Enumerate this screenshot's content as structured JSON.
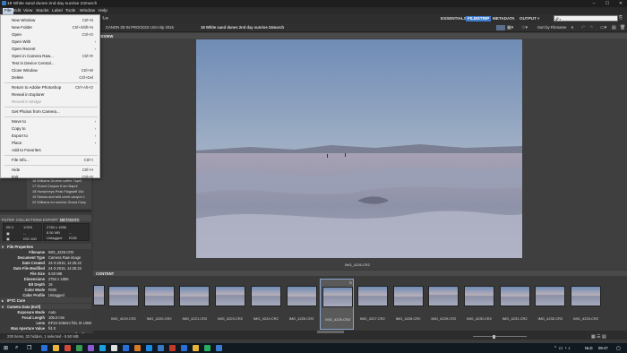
{
  "titlebar": {
    "title": "18 White sand dunes 2nd day sunrise 24march",
    "minimize": "–",
    "maximize": "☐",
    "close": "✕"
  },
  "menubar": {
    "items": [
      "File",
      "Edit",
      "View",
      "Stacks",
      "Label",
      "Tools",
      "Window",
      "Help"
    ]
  },
  "file_menu": {
    "groups": [
      [
        {
          "label": "New Window",
          "shortcut": "Ctrl+N"
        },
        {
          "label": "New Folder",
          "shortcut": "Ctrl+Shift+N"
        },
        {
          "label": "Open",
          "shortcut": "Ctrl+O"
        },
        {
          "label": "Open With",
          "submenu": true
        },
        {
          "label": "Open Recent",
          "submenu": true
        },
        {
          "label": "Open in Camera Raw...",
          "shortcut": "Ctrl+R"
        },
        {
          "label": "Test in Device Central..."
        },
        {
          "label": "Close Window",
          "shortcut": "Ctrl+W"
        },
        {
          "label": "Delete",
          "shortcut": "Ctrl+Del"
        }
      ],
      [
        {
          "label": "Return to Adobe Photoshop",
          "shortcut": "Ctrl+Alt+O"
        },
        {
          "label": "Reveal in Explorer"
        },
        {
          "label": "Reveal in Bridge",
          "disabled": true
        }
      ],
      [
        {
          "label": "Get Photos from Camera..."
        }
      ],
      [
        {
          "label": "Move to",
          "submenu": true
        },
        {
          "label": "Copy to",
          "submenu": true
        },
        {
          "label": "Export to",
          "submenu": true
        },
        {
          "label": "Place",
          "submenu": true
        },
        {
          "label": "Add to Favorites"
        }
      ],
      [
        {
          "label": "File Info...",
          "shortcut": "Ctrl+I"
        }
      ],
      [
        {
          "label": "Hide",
          "shortcut": "Ctrl+H"
        },
        {
          "label": "Exit",
          "shortcut": "Ctrl+Q"
        }
      ]
    ]
  },
  "workspaces": {
    "essentials": "ESSENTIALS",
    "filmstrip": "FILMSTRIP",
    "metadata": "METADATA",
    "output": "OUTPUT"
  },
  "search": {
    "placeholder": "𝒫 ▾"
  },
  "path": [
    "CANON 3D IN PROCESS",
    "USA trip 2015",
    "18 White sand dunes 2nd day sunrise 24march"
  ],
  "sort": {
    "label": "Sort by Filename"
  },
  "folders": [
    "16 Williams Grutnm coffee 7april",
    "17 Grand Canyon 8 arc Napril",
    "18 Humphreys Peak Flagstaff 10a",
    "19 Sidona and wild creek canyon 1",
    "20 Williams err sunrise Grand Cany"
  ],
  "left_tabs": {
    "filter": "FILTER",
    "collections": "COLLECTIONS",
    "export": "EXPORT",
    "metadata": "METADATA"
  },
  "meta_summary": {
    "aperture": "f/6.3",
    "shutter": "1/320",
    "size": "2784 x 1856",
    "filesize": "8.50 MB",
    "iso": "ISO 100",
    "tagged": "Untagged",
    "mode": "RGB"
  },
  "file_properties": {
    "header": "File Properties",
    "rows": [
      {
        "k": "Filename",
        "v": "IMG_4226.CR2"
      },
      {
        "k": "Document Type",
        "v": "Camera Raw image"
      },
      {
        "k": "Date Created",
        "v": "24-3-2015, 14:25:22"
      },
      {
        "k": "Date File Modified",
        "v": "24-3-2015, 14:25:22"
      },
      {
        "k": "File Size",
        "v": "8.50 MB"
      },
      {
        "k": "Dimensions",
        "v": "2784 x 1856"
      },
      {
        "k": "Bit Depth",
        "v": "16"
      },
      {
        "k": "Color Mode",
        "v": "RGB"
      },
      {
        "k": "Color Profile",
        "v": "Untagged"
      }
    ]
  },
  "iptc": {
    "header": "IPTC Core"
  },
  "camera_data": {
    "header": "Camera Data (Exif)",
    "rows": [
      {
        "k": "Exposure Mode",
        "v": "Auto"
      },
      {
        "k": "Focal Length",
        "v": "105.0 mm"
      },
      {
        "k": "Lens",
        "v": "EF24-105mm f/4L IS USM"
      },
      {
        "k": "Max Aperture Value",
        "v": "f/4.0"
      }
    ]
  },
  "preview": {
    "label": "PREVIEW",
    "caption": "IMG_4226.CR2"
  },
  "content": {
    "label": "CONTENT",
    "thumbs": [
      "IMG_4219.CR2",
      "IMG_4220.CR2",
      "IMG_4221.CR2",
      "IMG_4223.CR2",
      "IMG_4224.CR2",
      "IMG_4225.CR2",
      "IMG_4226.CR2",
      "IMG_4227.CR2",
      "IMG_4228.CR2",
      "IMG_4229.CR2",
      "IMG_4230.CR2",
      "IMG_4231.CR2",
      "IMG_4232.CR2",
      "IMG_4233.CR2"
    ],
    "selected_index": 6
  },
  "status": {
    "text": "230 items, 32 hidden, 1 selected - 8.50 MB"
  },
  "taskbar": {
    "time": "09:47",
    "lang": "NLD"
  },
  "colors": {
    "accent": "#3d7bd0",
    "menu_bg": "#f2f2f2"
  }
}
